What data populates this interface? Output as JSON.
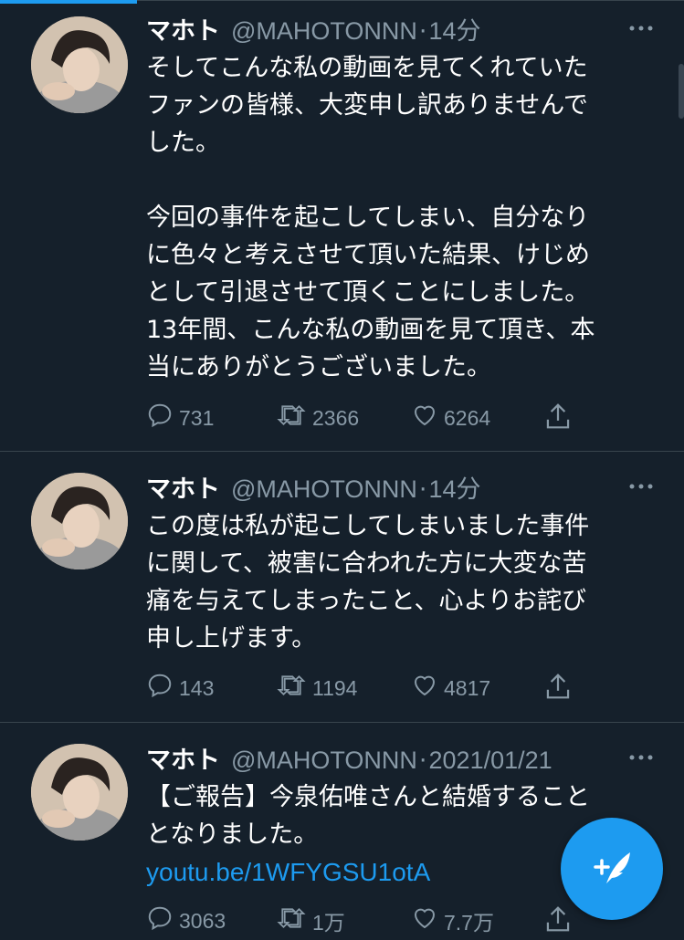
{
  "tweets": [
    {
      "name": "マホト",
      "handle": "@MAHOTONNN",
      "time": "14分",
      "lines": [
        "そしてこんな私の動画を見てくれていた",
        "ファンの皆様、大変申し訳ありませんで",
        "した。",
        "",
        "今回の事件を起こしてしまい、自分なり",
        "に色々と考えさせて頂いた結果、けじめ",
        "として引退させて頂くことにしました。",
        "13年間、こんな私の動画を見て頂き、本",
        "当にありがとうございました。"
      ],
      "replies": "731",
      "retweets": "2366",
      "likes": "6264"
    },
    {
      "name": "マホト",
      "handle": "@MAHOTONNN",
      "time": "14分",
      "lines": [
        "この度は私が起こしてしまいました事件",
        "に関して、被害に合われた方に大変な苦",
        "痛を与えてしまったこと、心よりお詫び",
        "申し上げます。"
      ],
      "replies": "143",
      "retweets": "1194",
      "likes": "4817"
    },
    {
      "name": "マホト",
      "handle": "@MAHOTONNN",
      "time": "2021/01/21",
      "lines": [
        "【ご報告】今泉佑唯さんと結婚すること",
        "となりました。"
      ],
      "link": "youtu.be/1WFYGSU1otA",
      "replies": "3063",
      "retweets": "1万",
      "likes": "7.7万"
    }
  ],
  "separator": "·",
  "colors": {
    "background": "#15202b",
    "accent": "#1d9bf0",
    "muted": "#8899a6",
    "divider": "#38444d"
  },
  "icons": [
    "reply-icon",
    "retweet-icon",
    "like-icon",
    "share-icon",
    "more-icon",
    "compose-tweet-icon"
  ]
}
